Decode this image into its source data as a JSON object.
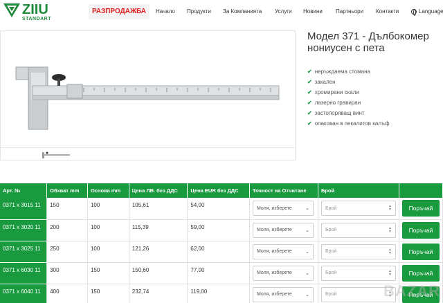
{
  "header": {
    "logo_text": "ZIIU",
    "logo_sub": "STANDART",
    "sale_label": "РАЗПРОДАЖБА",
    "nav": [
      "Начало",
      "Продукти",
      "За Компанията",
      "Услуги",
      "Новини",
      "Партньори",
      "Контакти"
    ],
    "language": "Language"
  },
  "product": {
    "title": "Модел 371 - Дълбокомер нониусен с пета",
    "features": [
      "неръждаема стомана",
      "закален",
      "хромирани скали",
      "лазерно гравиран",
      "застопоряващ винт",
      "опакован в пекалитов калъф"
    ]
  },
  "table": {
    "headers": [
      "Арт. №",
      "Обхват mm",
      "Основа mm",
      "Цена ЛВ. без ДДС",
      "Цена EUR без ДДС",
      "Точност на Отчитане",
      "Брой",
      ""
    ],
    "select_placeholder": "Моля, изберете",
    "qty_placeholder": "Брой",
    "order_label": "Поръчай",
    "rows": [
      {
        "art": "0371 x 3015 11",
        "range": "150",
        "base": "100",
        "bgn": "105,61",
        "eur": "54,00"
      },
      {
        "art": "0371 x 3020 11",
        "range": "200",
        "base": "100",
        "bgn": "115,39",
        "eur": "59,00"
      },
      {
        "art": "0371 x 3025 11",
        "range": "250",
        "base": "100",
        "bgn": "121,26",
        "eur": "62,00"
      },
      {
        "art": "0371 x 6030 11",
        "range": "300",
        "base": "150",
        "bgn": "150,60",
        "eur": "77,00"
      },
      {
        "art": "0371 x 6040 11",
        "range": "400",
        "base": "150",
        "bgn": "232,74",
        "eur": "119,00"
      }
    ]
  },
  "watermark": "BAZAR",
  "colors": {
    "brand_green": "#1a9a3f",
    "sale_red": "#e01f1f"
  }
}
